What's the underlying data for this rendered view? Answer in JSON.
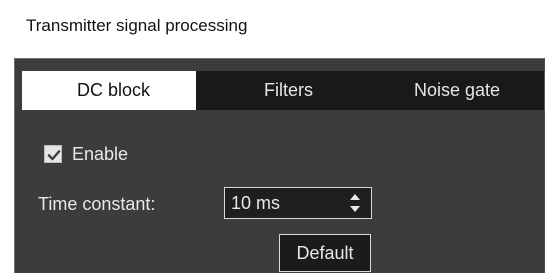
{
  "section": {
    "title": "Transmitter signal processing"
  },
  "tabs": [
    {
      "label": "DC block",
      "active": true
    },
    {
      "label": "Filters",
      "active": false
    },
    {
      "label": "Noise gate",
      "active": false
    }
  ],
  "dc_block": {
    "enable_label": "Enable",
    "enable_checked": true,
    "time_constant_label": "Time constant:",
    "time_constant_value": "10 ms",
    "default_label": "Default"
  },
  "icons": {
    "checkbox": "check-icon",
    "spin": "spin-arrows-icon"
  },
  "colors": {
    "panel_bg": "#3c3c3c",
    "tab_active_bg": "#ffffff",
    "tab_inactive_bg": "#191919",
    "text_light": "#e8e8e8"
  }
}
